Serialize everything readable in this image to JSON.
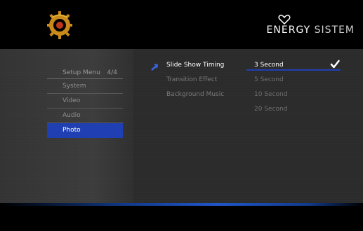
{
  "header": {
    "brand_left": "ENERGY",
    "brand_right": "SISTEM",
    "logo_icon": "gear-logo-icon",
    "heart_icon": "heart-icon"
  },
  "menu": {
    "title": "Setup Menu",
    "page": "4/4",
    "items": [
      {
        "label": "System"
      },
      {
        "label": "Video"
      },
      {
        "label": "Audio"
      },
      {
        "label": "Photo",
        "selected": true
      }
    ]
  },
  "settings": {
    "rows": [
      {
        "label": "Slide Show Timing",
        "option": "3 Second",
        "active": true
      },
      {
        "label": "Transition Effect",
        "option": "5 Second",
        "active": false
      },
      {
        "label": "Background Music",
        "option": "10 Second",
        "active": false
      },
      {
        "label": "",
        "option": "20 Second",
        "active": false
      }
    ]
  },
  "colors": {
    "accent_blue": "#1f3fb3",
    "background": "#2b2b2b",
    "panel": "#3a3a3a"
  }
}
